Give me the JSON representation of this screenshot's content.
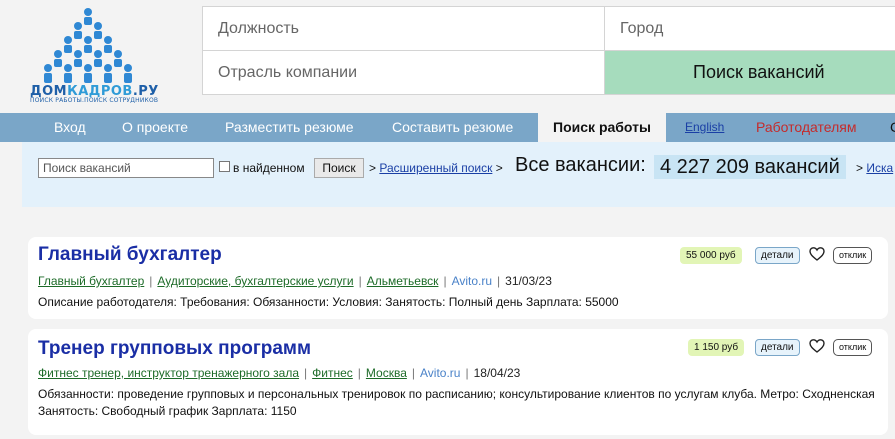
{
  "logo": {
    "text_a": "ДОМ",
    "text_b": "КАДРОВ",
    "text_c": ".РУ",
    "subtitle": "ПОИСК РАБОТЫ.ПОИСК СОТРУДНИКОВ"
  },
  "search_form": {
    "position_placeholder": "Должность",
    "city_placeholder": "Город",
    "industry_placeholder": "Отрасль компании",
    "search_button": "Поиск вакансий"
  },
  "nav": {
    "items": [
      "Вход",
      "О проекте",
      "Разместить резюме",
      "Составить резюме",
      "Поиск работы",
      "English",
      "Работодателям",
      "С"
    ]
  },
  "quick_search": {
    "placeholder": "Поиск вакансий",
    "in_found_label": "в найденном",
    "button": "Поиск",
    "advanced_link": "Расширенный поиск",
    "sep": ">",
    "all_label": "Все вакансии:",
    "count": "4 227 209 вакансий",
    "next_link": "Иска"
  },
  "vacancies": [
    {
      "title": "Главный бухгалтер",
      "position": "Главный бухгалтер",
      "industry": "Аудиторские, бухгалтерские услуги",
      "city": "Альметьевск",
      "source": "Avito.ru",
      "date": "31/03/23",
      "description": "Описание работодателя: Требования: Обязанности: Условия: Занятость: Полный день Зарплата: 55000",
      "salary": "55 000 руб",
      "details_label": "детали",
      "respond_label": "отклик"
    },
    {
      "title": "Тренер групповых программ",
      "position": "Фитнес тренер, инструктор тренажерного зала",
      "industry": "Фитнес",
      "city": "Москва",
      "source": "Avito.ru",
      "date": "18/04/23",
      "description": "Обязанности: проведение групповых и персональных тренировок по расписанию; консультирование клиентов по услугам клуба. Метро: Сходненская Занятость: Свободный график Зарплата: 1150",
      "salary": "1 150 руб",
      "details_label": "детали",
      "respond_label": "отклик"
    }
  ],
  "meta_sep": "|",
  "colors": {
    "nav_bg": "#7aa6c8",
    "search_button": "#a6dcbd",
    "subbar": "#e3f1fb",
    "title": "#1a2ea5"
  },
  "icons": {
    "heart": "heart-icon",
    "logo": "people-pyramid-logo"
  }
}
